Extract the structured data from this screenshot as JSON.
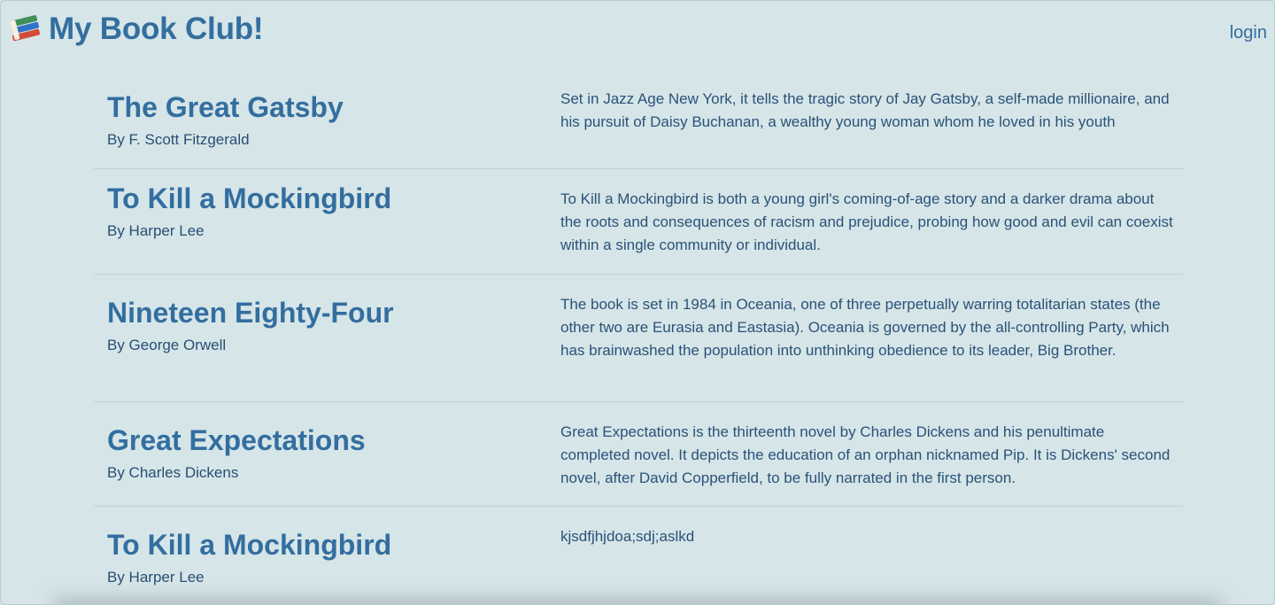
{
  "header": {
    "brand": "My Book Club!",
    "brand_icon": "books-icon",
    "login_label": "login"
  },
  "books": [
    {
      "title": "The Great Gatsby",
      "author": "By F. Scott Fitzgerald",
      "description": "Set in Jazz Age New York, it tells the tragic story of Jay Gatsby, a self-made millionaire, and his pursuit of Daisy Buchanan, a wealthy young woman whom he loved in his youth"
    },
    {
      "title": "To Kill a Mockingbird",
      "author": "By Harper Lee",
      "description": "To Kill a Mockingbird is both a young girl's coming-of-age story and a darker drama about the roots and consequences of racism and prejudice, probing how good and evil can coexist within a single community or individual."
    },
    {
      "title": "Nineteen Eighty-Four",
      "author": "By George Orwell",
      "description": "The book is set in 1984 in Oceania, one of three perpetually warring totalitarian states (the other two are Eurasia and Eastasia). Oceania is governed by the all-controlling Party, which has brainwashed the population into unthinking obedience to its leader, Big Brother."
    },
    {
      "title": "Great Expectations",
      "author": "By Charles Dickens",
      "description": "Great Expectations is the thirteenth novel by Charles Dickens and his penultimate completed novel. It depicts the education of an orphan nicknamed Pip. It is Dickens' second novel, after David Copperfield, to be fully narrated in the first person."
    },
    {
      "title": "To Kill a Mockingbird",
      "author": "By Harper Lee",
      "description": "kjsdfjhjdoa;sdj;aslkd"
    }
  ]
}
